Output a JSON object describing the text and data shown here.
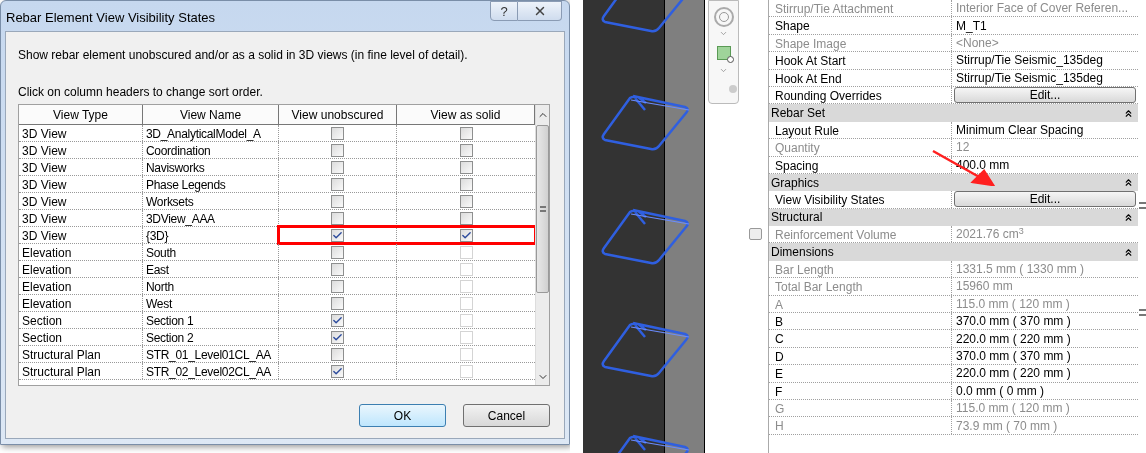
{
  "dialog": {
    "title": "Rebar Element View Visibility States",
    "help_button": "?",
    "description": "Show rebar element unobscured and/or as a solid in 3D views (in fine level of detail).",
    "hint": "Click on column headers to change sort order.",
    "table": {
      "columns": [
        "View Type",
        "View Name",
        "View unobscured",
        "View as solid"
      ],
      "rows": [
        {
          "view_type": "3D View",
          "view_name": "3D_AnalyticalModel_A",
          "unobscured_checked": false,
          "solid_checked": false,
          "solid_disabled": false,
          "highlighted": false
        },
        {
          "view_type": "3D View",
          "view_name": "Coordination",
          "unobscured_checked": false,
          "solid_checked": false,
          "solid_disabled": false,
          "highlighted": false
        },
        {
          "view_type": "3D View",
          "view_name": "Navisworks",
          "unobscured_checked": false,
          "solid_checked": false,
          "solid_disabled": false,
          "highlighted": false
        },
        {
          "view_type": "3D View",
          "view_name": "Phase Legends",
          "unobscured_checked": false,
          "solid_checked": false,
          "solid_disabled": false,
          "highlighted": false
        },
        {
          "view_type": "3D View",
          "view_name": "Worksets",
          "unobscured_checked": false,
          "solid_checked": false,
          "solid_disabled": false,
          "highlighted": false
        },
        {
          "view_type": "3D View",
          "view_name": "3DView_AAA",
          "unobscured_checked": false,
          "solid_checked": false,
          "solid_disabled": false,
          "highlighted": false
        },
        {
          "view_type": "3D View",
          "view_name": "{3D}",
          "unobscured_checked": true,
          "solid_checked": true,
          "solid_disabled": false,
          "highlighted": true
        },
        {
          "view_type": "Elevation",
          "view_name": "South",
          "unobscured_checked": false,
          "solid_checked": false,
          "solid_disabled": true,
          "highlighted": false
        },
        {
          "view_type": "Elevation",
          "view_name": "East",
          "unobscured_checked": false,
          "solid_checked": false,
          "solid_disabled": true,
          "highlighted": false
        },
        {
          "view_type": "Elevation",
          "view_name": "North",
          "unobscured_checked": false,
          "solid_checked": false,
          "solid_disabled": true,
          "highlighted": false
        },
        {
          "view_type": "Elevation",
          "view_name": "West",
          "unobscured_checked": false,
          "solid_checked": false,
          "solid_disabled": true,
          "highlighted": false
        },
        {
          "view_type": "Section",
          "view_name": "Section 1",
          "unobscured_checked": true,
          "solid_checked": false,
          "solid_disabled": true,
          "highlighted": false
        },
        {
          "view_type": "Section",
          "view_name": "Section 2",
          "unobscured_checked": true,
          "solid_checked": false,
          "solid_disabled": true,
          "highlighted": false
        },
        {
          "view_type": "Structural Plan",
          "view_name": "STR_01_Level01CL_AA",
          "unobscured_checked": false,
          "solid_checked": false,
          "solid_disabled": true,
          "highlighted": false
        },
        {
          "view_type": "Structural Plan",
          "view_name": "STR_02_Level02CL_AA",
          "unobscured_checked": true,
          "solid_checked": false,
          "solid_disabled": true,
          "highlighted": false
        }
      ]
    },
    "buttons": [
      {
        "label": "OK",
        "default": true
      },
      {
        "label": "Cancel",
        "default": false
      }
    ]
  },
  "properties": {
    "rows": [
      {
        "kind": "property",
        "label": "Stirrup/Tie Attachment",
        "value": "Interior Face of Cover Referen...",
        "disabled": true
      },
      {
        "kind": "property",
        "label": "Shape",
        "value": "M_T1",
        "disabled": false
      },
      {
        "kind": "property",
        "label": "Shape Image",
        "value": "<None>",
        "disabled": true
      },
      {
        "kind": "property",
        "label": "Hook At Start",
        "value": "Stirrup/Tie Seismic_135deg",
        "disabled": false
      },
      {
        "kind": "property",
        "label": "Hook At End",
        "value": "Stirrup/Tie Seismic_135deg",
        "disabled": false
      },
      {
        "kind": "button",
        "label": "Rounding Overrides",
        "value": "Edit...",
        "disabled": false
      },
      {
        "kind": "header",
        "label": "Rebar Set"
      },
      {
        "kind": "property",
        "label": "Layout Rule",
        "value": "Minimum Clear Spacing",
        "disabled": false
      },
      {
        "kind": "property",
        "label": "Quantity",
        "value": "12",
        "disabled": true
      },
      {
        "kind": "property",
        "label": "Spacing",
        "value": "400.0 mm",
        "disabled": false
      },
      {
        "kind": "header",
        "label": "Graphics"
      },
      {
        "kind": "button",
        "label": "View Visibility States",
        "value": "Edit...",
        "disabled": false
      },
      {
        "kind": "header",
        "label": "Structural"
      },
      {
        "kind": "property",
        "label": "Reinforcement Volume",
        "value": "2021.76 cm$^{3}$",
        "disabled": true
      },
      {
        "kind": "header",
        "label": "Dimensions"
      },
      {
        "kind": "property",
        "label": "Bar Length",
        "value": "1331.5 mm ( 1330 mm )",
        "disabled": true
      },
      {
        "kind": "property",
        "label": "Total Bar Length",
        "value": "15960 mm",
        "disabled": true
      },
      {
        "kind": "property",
        "label": "A",
        "value": "115.0 mm ( 120 mm )",
        "disabled": true
      },
      {
        "kind": "property",
        "label": "B",
        "value": "370.0 mm ( 370 mm )",
        "disabled": false
      },
      {
        "kind": "property",
        "label": "C",
        "value": "220.0 mm ( 220 mm )",
        "disabled": false
      },
      {
        "kind": "property",
        "label": "D",
        "value": "370.0 mm ( 370 mm )",
        "disabled": false
      },
      {
        "kind": "property",
        "label": "E",
        "value": "220.0 mm ( 220 mm )",
        "disabled": false
      },
      {
        "kind": "property",
        "label": "F",
        "value": "0.0 mm ( 0 mm )",
        "disabled": false
      },
      {
        "kind": "property",
        "label": "G",
        "value": "115.0 mm ( 120 mm )",
        "disabled": true
      },
      {
        "kind": "property",
        "label": "H",
        "value": "73.9 mm ( 70 mm )",
        "disabled": true
      }
    ]
  }
}
